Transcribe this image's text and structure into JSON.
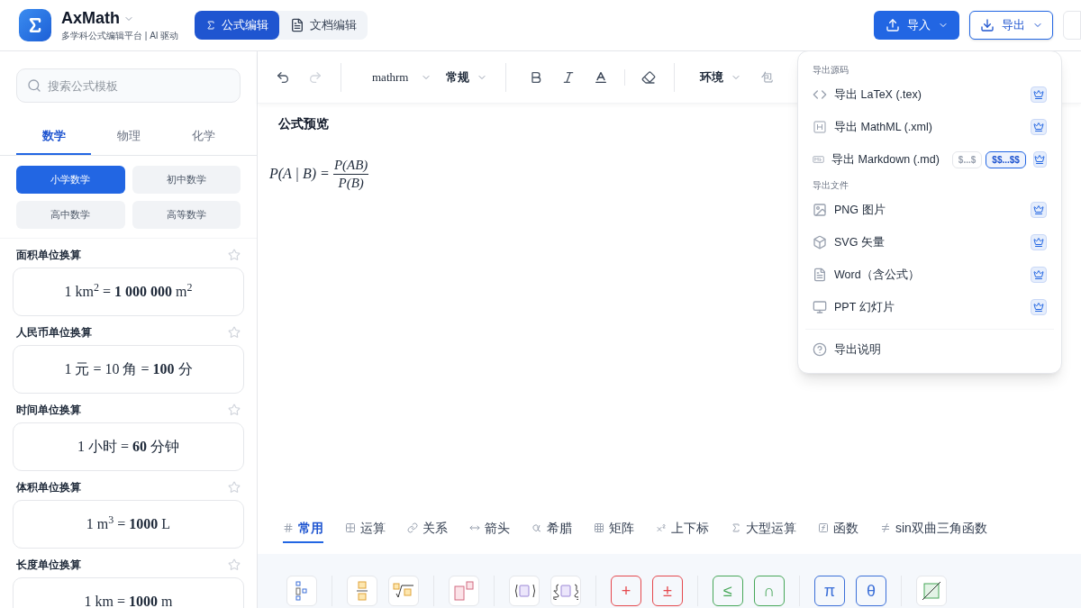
{
  "app": {
    "name": "AxMath",
    "subtitle": "多学科公式编辑平台 | AI 驱动"
  },
  "modes": [
    {
      "label": "公式编辑",
      "selected": true
    },
    {
      "label": "文档编辑",
      "selected": false
    }
  ],
  "header_actions": {
    "import": "导入",
    "export": {
      "label": "导出",
      "expanded": true
    }
  },
  "sidebar": {
    "search": {
      "placeholder": "搜索公式模板"
    },
    "subjects": [
      {
        "label": "数学",
        "selected": true
      },
      {
        "label": "物理",
        "selected": false
      },
      {
        "label": "化学",
        "selected": false
      }
    ],
    "grades": [
      {
        "label": "小学数学",
        "selected": true
      },
      {
        "label": "初中数学",
        "selected": false
      },
      {
        "label": "高中数学",
        "selected": false
      },
      {
        "label": "高等数学",
        "selected": false
      }
    ],
    "templates": [
      {
        "title": "面积单位换算",
        "formula": "1 km$^{2}$ = **1 000 000** m$^{2}$",
        "starred": false
      },
      {
        "title": "人民币单位换算",
        "formula": "1 元 = 10 角 = **100** 分",
        "starred": false
      },
      {
        "title": "时间单位换算",
        "formula": "1 小时 = **60** 分钟",
        "starred": false
      },
      {
        "title": "体积单位换算",
        "formula": "1 m$^{3}$ = **1000** L",
        "starred": false
      },
      {
        "title": "长度单位换算",
        "formula": "1 km = **1000** m",
        "starred": false
      }
    ]
  },
  "toolbar": {
    "undo": {
      "disabled": false
    },
    "redo": {
      "disabled": true
    },
    "font": "mathrm",
    "weight": "常规",
    "environment": "环境",
    "wrap": {
      "label": "包",
      "disabled": true
    }
  },
  "preview": {
    "title": "公式预览",
    "lhs": "P(A | B) =",
    "numerator": "P(AB)",
    "denominator": "P(B)"
  },
  "categories": [
    {
      "label": "常用",
      "selected": true
    },
    {
      "label": "运算",
      "selected": false
    },
    {
      "label": "关系",
      "selected": false
    },
    {
      "label": "箭头",
      "selected": false
    },
    {
      "label": "希腊",
      "selected": false
    },
    {
      "label": "矩阵",
      "selected": false
    },
    {
      "label": "上下标",
      "selected": false
    },
    {
      "label": "大型运算",
      "selected": false
    },
    {
      "label": "函数",
      "selected": false
    },
    {
      "label": "sin双曲三角函数",
      "selected": false
    }
  ],
  "palette": [
    [
      {
        "kind": "stack"
      }
    ],
    [
      {
        "kind": "fraction"
      },
      {
        "kind": "root"
      }
    ],
    [
      {
        "kind": "script"
      }
    ],
    [
      {
        "kind": "parens"
      },
      {
        "kind": "braces"
      }
    ],
    [
      {
        "kind": "symbol",
        "text": "+",
        "color": "#e5484d"
      },
      {
        "kind": "symbol",
        "text": "±",
        "color": "#e5484d"
      }
    ],
    [
      {
        "kind": "symbol",
        "text": "≤",
        "color": "#46a758"
      },
      {
        "kind": "symbol",
        "text": "∩",
        "color": "#46a758"
      }
    ],
    [
      {
        "kind": "symbol",
        "text": "π",
        "color": "#3b6fd8"
      },
      {
        "kind": "symbol",
        "text": "θ",
        "color": "#3b6fd8"
      }
    ],
    [
      {
        "kind": "strike"
      }
    ]
  ],
  "export_menu": {
    "sections": [
      {
        "title": "导出源码",
        "items": [
          {
            "kind": "code",
            "label": "导出 LaTeX (.tex)"
          },
          {
            "kind": "ml",
            "label": "导出 MathML (.xml)"
          },
          {
            "kind": "md",
            "label": "导出 Markdown (.md)",
            "options": [
              {
                "label": "$...$",
                "selected": false
              },
              {
                "label": "$$...$$",
                "selected": true
              }
            ]
          }
        ]
      },
      {
        "title": "导出文件",
        "items": [
          {
            "kind": "image",
            "label": "PNG 图片"
          },
          {
            "kind": "cube",
            "label": "SVG 矢量"
          },
          {
            "kind": "doc",
            "label": "Word（含公式）"
          },
          {
            "kind": "monitor",
            "label": "PPT 幻灯片"
          }
        ]
      }
    ],
    "help": "导出说明"
  }
}
